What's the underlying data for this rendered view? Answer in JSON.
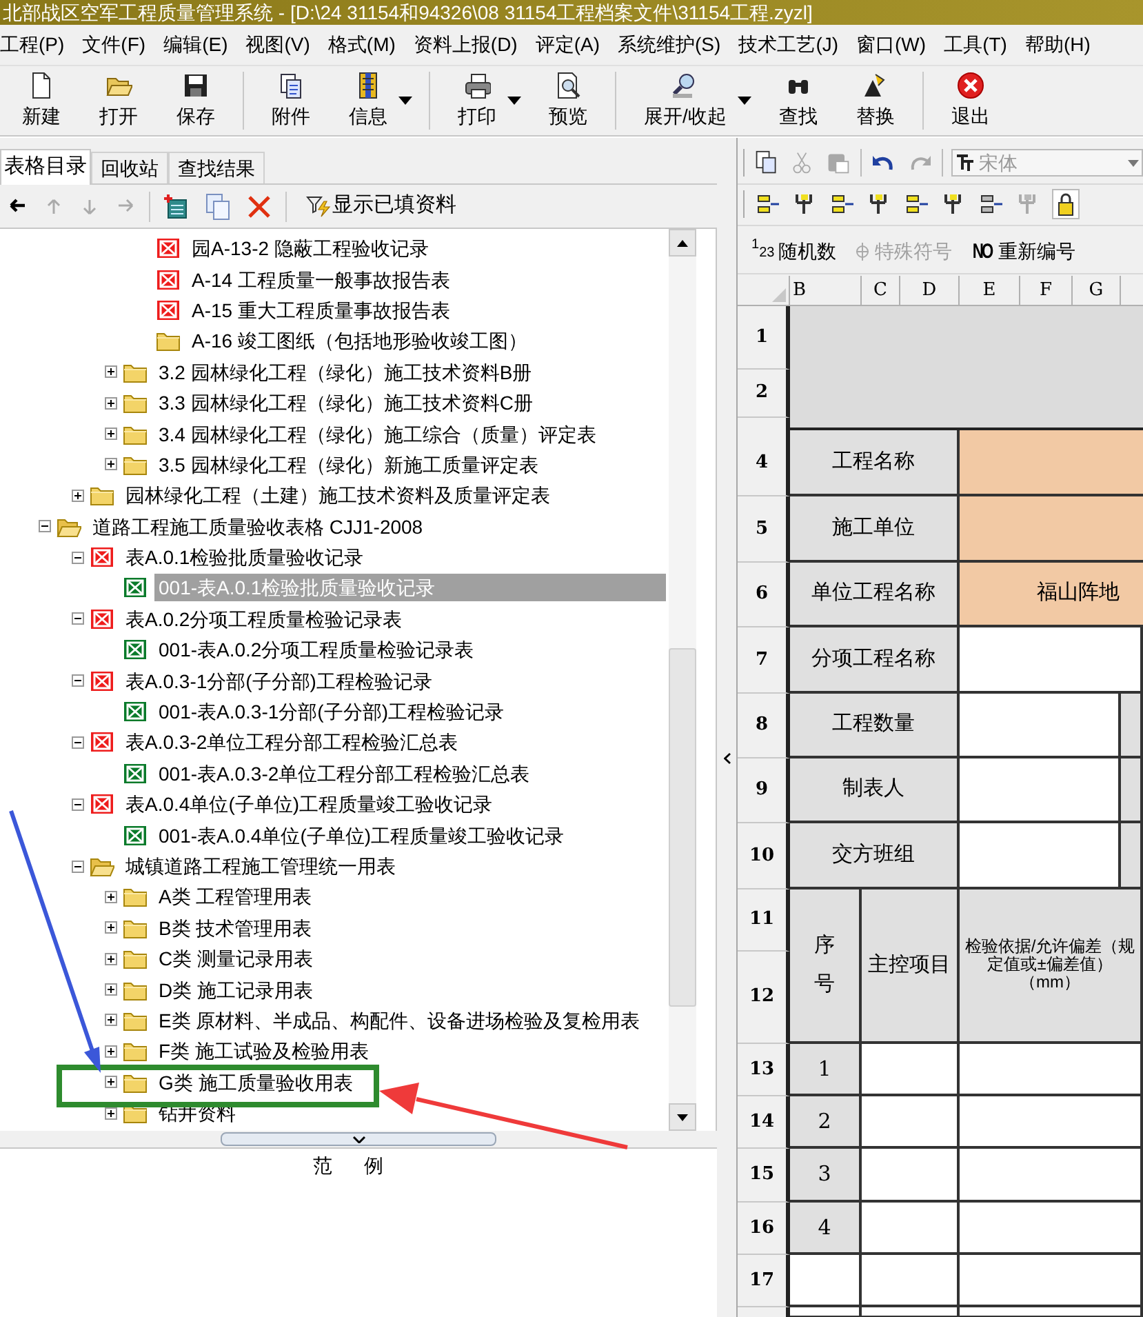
{
  "window": {
    "title": "北部战区空军工程质量管理系统 - [D:\\24  31154和94326\\08  31154工程档案文件\\31154工程.zyzl]"
  },
  "menu": [
    "工程(P)",
    "文件(F)",
    "编辑(E)",
    "视图(V)",
    "格式(M)",
    "资料上报(D)",
    "评定(A)",
    "系统维护(S)",
    "技术工艺(J)",
    "窗口(W)",
    "工具(T)",
    "帮助(H)"
  ],
  "toolbar": [
    [
      {
        "label": "新建",
        "has_menu": false
      },
      {
        "label": "打开",
        "has_menu": false
      },
      {
        "label": "保存",
        "has_menu": false
      }
    ],
    [
      {
        "label": "附件",
        "has_menu": false
      },
      {
        "label": "信息",
        "has_menu": true
      }
    ],
    [
      {
        "label": "打印",
        "has_menu": true
      },
      {
        "label": "预览",
        "has_menu": false
      }
    ],
    [
      {
        "label": "展开/收起",
        "has_menu": true
      },
      {
        "label": "查找",
        "has_menu": false
      },
      {
        "label": "替换",
        "has_menu": false
      }
    ],
    [
      {
        "label": "退出",
        "has_menu": false
      }
    ]
  ],
  "tabs": [
    {
      "label": "表格目录",
      "selected": true
    },
    {
      "label": "回收站",
      "selected": false
    },
    {
      "label": "查找结果",
      "selected": false
    }
  ],
  "tree_toolbar": {
    "nav": [
      {
        "disabled": false
      },
      {
        "disabled": true
      },
      {
        "disabled": true
      },
      {
        "disabled": true
      }
    ],
    "filter_label": "显示已填资料"
  },
  "tree": {
    "items": [
      {
        "children": [
          {
            "children": [
              {
                "children": [
                  {
                    "children": [
                      {
                        "label": "园A-13-2 隐蔽工程验收记录",
                        "kind": "empty_form",
                        "selected": false
                      },
                      {
                        "label": "A-14 工程质量一般事故报告表",
                        "kind": "empty_form",
                        "selected": false
                      },
                      {
                        "label": "A-15 重大工程质量事故报告表",
                        "kind": "empty_form",
                        "selected": false
                      },
                      {
                        "label": "A-16 竣工图纸（包括地形验收竣工图）",
                        "kind": "folder",
                        "selected": false
                      }
                    ]
                  },
                  {
                    "label": "3.2 园林绿化工程（绿化）施工技术资料B册",
                    "kind": "folder",
                    "expanded": false,
                    "selected": false
                  },
                  {
                    "label": "3.3 园林绿化工程（绿化）施工技术资料C册",
                    "kind": "folder",
                    "expanded": false,
                    "selected": false
                  },
                  {
                    "label": "3.4 园林绿化工程（绿化）施工综合（质量）评定表",
                    "kind": "folder",
                    "expanded": false,
                    "selected": false
                  },
                  {
                    "label": "3.5 园林绿化工程（绿化）新施工质量评定表",
                    "kind": "folder",
                    "expanded": false,
                    "selected": false
                  }
                ]
              },
              {
                "label": "园林绿化工程（土建）施工技术资料及质量评定表",
                "kind": "folder",
                "expanded": false,
                "selected": false
              }
            ]
          },
          {
            "label": "道路工程施工质量验收表格 CJJ1-2008",
            "kind": "open_folder",
            "expanded": true,
            "selected": false,
            "children": [
              {
                "label": "表A.0.1检验批质量验收记录",
                "kind": "empty_form",
                "expanded": true,
                "selected": false,
                "children": [
                  {
                    "label": "001-表A.0.1检验批质量验收记录",
                    "kind": "filled_form",
                    "selected": true
                  }
                ]
              },
              {
                "label": "表A.0.2分项工程质量检验记录表",
                "kind": "empty_form",
                "expanded": true,
                "selected": false,
                "children": [
                  {
                    "label": "001-表A.0.2分项工程质量检验记录表",
                    "kind": "filled_form",
                    "selected": false
                  }
                ]
              },
              {
                "label": "表A.0.3-1分部(子分部)工程检验记录",
                "kind": "empty_form",
                "expanded": true,
                "selected": false,
                "children": [
                  {
                    "label": "001-表A.0.3-1分部(子分部)工程检验记录",
                    "kind": "filled_form",
                    "selected": false
                  }
                ]
              },
              {
                "label": "表A.0.3-2单位工程分部工程检验汇总表",
                "kind": "empty_form",
                "expanded": true,
                "selected": false,
                "children": [
                  {
                    "label": "001-表A.0.3-2单位工程分部工程检验汇总表",
                    "kind": "filled_form",
                    "selected": false
                  }
                ]
              },
              {
                "label": "表A.0.4单位(子单位)工程质量竣工验收记录",
                "kind": "empty_form",
                "expanded": true,
                "selected": false,
                "children": [
                  {
                    "label": "001-表A.0.4单位(子单位)工程质量竣工验收记录",
                    "kind": "filled_form",
                    "selected": false
                  }
                ]
              },
              {
                "label": "城镇道路工程施工管理统一用表",
                "kind": "open_folder",
                "expanded": true,
                "selected": false,
                "children": [
                  {
                    "label": "A类  工程管理用表",
                    "kind": "folder",
                    "expanded": false,
                    "selected": false
                  },
                  {
                    "label": "B类  技术管理用表",
                    "kind": "folder",
                    "expanded": false,
                    "selected": false
                  },
                  {
                    "label": "C类  测量记录用表",
                    "kind": "folder",
                    "expanded": false,
                    "selected": false
                  },
                  {
                    "label": "D类  施工记录用表",
                    "kind": "folder",
                    "expanded": false,
                    "selected": false
                  },
                  {
                    "label": "E类  原材料、半成品、构配件、设备进场检验及复检用表",
                    "kind": "folder",
                    "expanded": false,
                    "selected": false
                  },
                  {
                    "label": "F类  施工试验及检验用表",
                    "kind": "folder",
                    "expanded": false,
                    "selected": false
                  },
                  {
                    "label": "G类  施工质量验收用表",
                    "kind": "folder",
                    "expanded": false,
                    "selected": false
                  },
                  {
                    "label": "钻井资料",
                    "kind": "folder",
                    "expanded": false,
                    "selected": false
                  }
                ]
              }
            ]
          }
        ]
      }
    ]
  },
  "legend": {
    "title": "范      例"
  },
  "edit_toolbar": {
    "buttons": [
      {
        "disabled": false
      },
      {
        "disabled": true
      },
      {
        "disabled": true
      },
      {
        "disabled": false
      },
      {
        "disabled": true
      }
    ],
    "font": {
      "value": "宋体"
    }
  },
  "format_toolbar": {
    "buttons": [
      {
        "disabled": false
      },
      {
        "disabled": false
      },
      {
        "disabled": false
      },
      {
        "disabled": false
      },
      {
        "disabled": false
      },
      {
        "disabled": false
      },
      {
        "disabled": true
      },
      {
        "disabled": true
      },
      {
        "disabled": false
      }
    ]
  },
  "tools_toolbar": [
    {
      "icon_text": "123",
      "label": "随机数",
      "disabled": false
    },
    {
      "label": "特殊符号",
      "disabled": true
    },
    {
      "icon_text": "NO",
      "label": "重新编号",
      "disabled": false
    }
  ],
  "sheet": {
    "columns": [
      "B",
      "C",
      "D",
      "E",
      "F",
      "G"
    ],
    "row_headers": [
      "1",
      "2",
      "4",
      "5",
      "6",
      "7",
      "8",
      "9",
      "10",
      "11",
      "12",
      "13",
      "14",
      "15",
      "16",
      "17"
    ],
    "cells": [
      {
        "kind": "title"
      },
      {
        "kind": "label",
        "text": "工程名称"
      },
      {
        "kind": "highlight"
      },
      {
        "kind": "label",
        "text": "施工单位"
      },
      {
        "kind": "highlight"
      },
      {
        "kind": "label",
        "text": "单位工程名称"
      },
      {
        "kind": "highlight",
        "text": "福山阵地"
      },
      {
        "kind": "label",
        "text": "分项工程名称"
      },
      {
        "kind": "blank"
      },
      {
        "kind": "label",
        "text": "工程数量"
      },
      {
        "kind": "blank"
      },
      {
        "kind": "label"
      },
      {
        "kind": "label",
        "text": "制表人"
      },
      {
        "kind": "blank"
      },
      {
        "kind": "label"
      },
      {
        "kind": "label",
        "text": "交方班组"
      },
      {
        "kind": "blank"
      },
      {
        "kind": "label"
      },
      {
        "kind": "label",
        "text": "序号"
      },
      {
        "kind": "label",
        "text": "主控项目"
      },
      {
        "kind": "label",
        "text": "检验依据/允许偏差（规定值或±偏差值）（mm）"
      },
      {
        "kind": "label",
        "text": "1"
      },
      {
        "kind": "blank"
      },
      {
        "kind": "blank"
      },
      {
        "kind": "label",
        "text": "2"
      },
      {
        "kind": "blank"
      },
      {
        "kind": "blank"
      },
      {
        "kind": "label",
        "text": "3"
      },
      {
        "kind": "blank"
      },
      {
        "kind": "blank"
      },
      {
        "kind": "label",
        "text": "4"
      },
      {
        "kind": "blank"
      },
      {
        "kind": "blank"
      },
      {
        "kind": "blank"
      },
      {
        "kind": "blank"
      },
      {
        "kind": "blank"
      },
      {
        "kind": "blank"
      },
      {
        "kind": "blank"
      },
      {
        "kind": "blank"
      }
    ]
  },
  "annotations": [
    {
      "kind": "box",
      "color": "#2e8b2e"
    },
    {
      "kind": "arrow",
      "color": "#3b57d9"
    },
    {
      "kind": "arrow",
      "color": "#ef3a3a"
    }
  ]
}
